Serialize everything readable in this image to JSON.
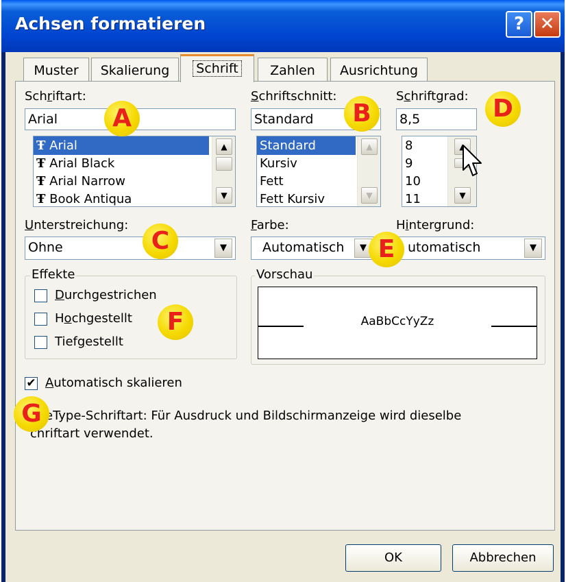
{
  "window": {
    "title": "Achsen formatieren",
    "help_glyph": "?",
    "close_glyph": "✕"
  },
  "tabs": [
    "Muster",
    "Skalierung",
    "Schrift",
    "Zahlen",
    "Ausrichtung"
  ],
  "active_tab": "Schrift",
  "font": {
    "label": "Schriftart:",
    "value": "Arial",
    "items": [
      "Arial",
      "Arial Black",
      "Arial Narrow",
      "Book Antiqua"
    ],
    "selected": "Arial",
    "item_icon": "truetype-font-icon"
  },
  "style": {
    "label": "Schriftschnitt:",
    "value": "Standard",
    "items": [
      "Standard",
      "Kursiv",
      "Fett",
      "Fett Kursiv"
    ],
    "selected": "Standard"
  },
  "size": {
    "label": "Schriftgrad:",
    "value": "8,5",
    "items": [
      "8",
      "9",
      "10",
      "11"
    ]
  },
  "underline": {
    "label": "Unterstreichung:",
    "value": "Ohne"
  },
  "color": {
    "label": "Farbe:",
    "value": "Automatisch"
  },
  "background": {
    "label": "Hintergrund:",
    "value": "Automatisch",
    "value_visible": "utomatisch"
  },
  "effects": {
    "title": "Effekte",
    "strikethrough": {
      "label": "Durchgestrichen",
      "checked": false
    },
    "superscript": {
      "label": "Hochgestellt",
      "checked": false
    },
    "subscript": {
      "label": "Tiefgestellt",
      "checked": false
    }
  },
  "preview": {
    "title": "Vorschau",
    "sample": "AaBbCcYyZz"
  },
  "autoscale": {
    "label": "Automatisch skalieren",
    "checked": true
  },
  "info": {
    "line1": "eType-Schriftart: Für Ausdruck und Bildschirmanzeige wird dieselbe",
    "line2": "chriftart verwendet."
  },
  "buttons": {
    "ok": "OK",
    "cancel": "Abbrechen"
  },
  "annotations": [
    "A",
    "B",
    "C",
    "D",
    "E",
    "F",
    "G"
  ],
  "colors": {
    "title_bar": "#0054e3",
    "selection": "#316ac5",
    "marker_fill": "#f5d900",
    "marker_text": "#e8211a",
    "dialog_bg": "#ece9d8"
  }
}
